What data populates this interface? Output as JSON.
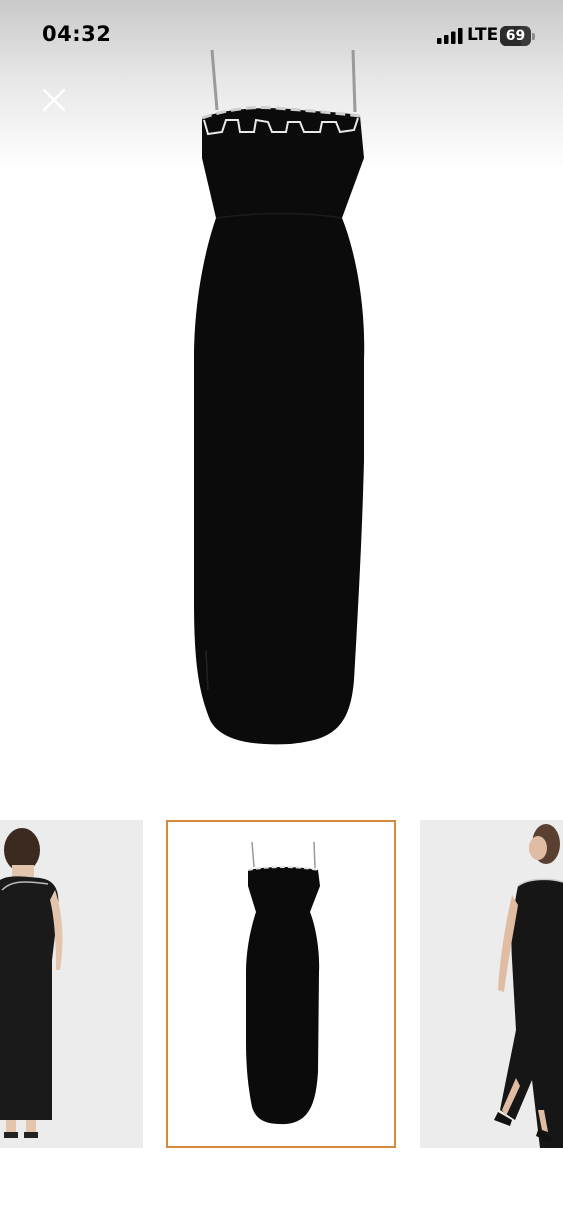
{
  "status_bar": {
    "time": "04:32",
    "network": "LTE",
    "battery_level": 69,
    "battery_text": "69",
    "signal_icon": "signal-bars-icon",
    "battery_icon": "battery-icon"
  },
  "viewer": {
    "close_icon": "close-icon",
    "main_image": "black-maxi-dress-front"
  },
  "thumbnails": [
    {
      "image": "model-back-view",
      "selected": false
    },
    {
      "image": "black-maxi-dress-front",
      "selected": true
    },
    {
      "image": "model-side-view",
      "selected": false
    }
  ],
  "colors": {
    "selected_border": "#d9893a",
    "dress": "#0b0b0b",
    "thumb_background": "#ececec"
  }
}
